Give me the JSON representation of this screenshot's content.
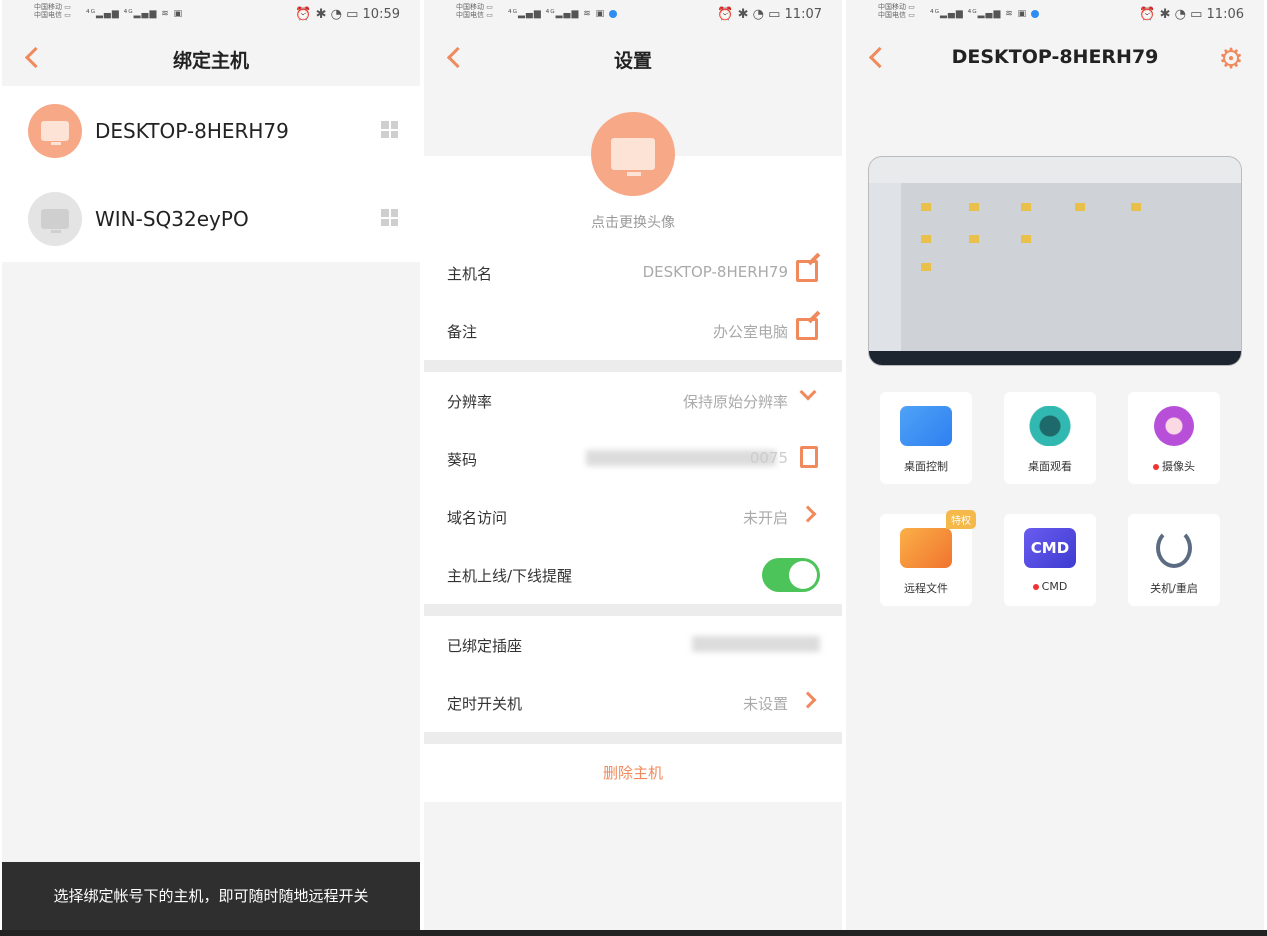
{
  "screen1": {
    "time": "10:59",
    "title": "绑定主机",
    "hosts": [
      {
        "name": "DESKTOP-8HERH79",
        "status": "online"
      },
      {
        "name": "WIN-SQ32eyPO",
        "status": "offline"
      }
    ],
    "toast": "选择绑定帐号下的主机，即可随时随地远程开关"
  },
  "screen2": {
    "time": "11:07",
    "title": "设置",
    "avatar_hint": "点击更换头像",
    "rows": {
      "hostname": {
        "label": "主机名",
        "value": "DESKTOP-8HERH79"
      },
      "remark": {
        "label": "备注",
        "value": "办公室电脑"
      },
      "resolution": {
        "label": "分辨率",
        "value": "保持原始分辨率"
      },
      "code": {
        "label": "葵码",
        "value": "0075"
      },
      "domain": {
        "label": "域名访问",
        "value": "未开启"
      },
      "notify": {
        "label": "主机上线/下线提醒",
        "enabled": true
      },
      "socket": {
        "label": "已绑定插座",
        "value": ""
      },
      "schedule": {
        "label": "定时开关机",
        "value": "未设置"
      }
    },
    "delete": "删除主机"
  },
  "screen3": {
    "time": "11:06",
    "title": "DESKTOP-8HERH79",
    "tiles": [
      {
        "label": "桌面控制",
        "dot": false
      },
      {
        "label": "桌面观看",
        "dot": false
      },
      {
        "label": "摄像头",
        "dot": true
      },
      {
        "label": "远程文件",
        "dot": false,
        "badge": "特权"
      },
      {
        "label": "CMD",
        "dot": true,
        "icon_text": "CMD"
      },
      {
        "label": "关机/重启",
        "dot": false
      }
    ]
  },
  "colors": {
    "accent": "#f08a5d",
    "toggle_on": "#4cc459"
  }
}
